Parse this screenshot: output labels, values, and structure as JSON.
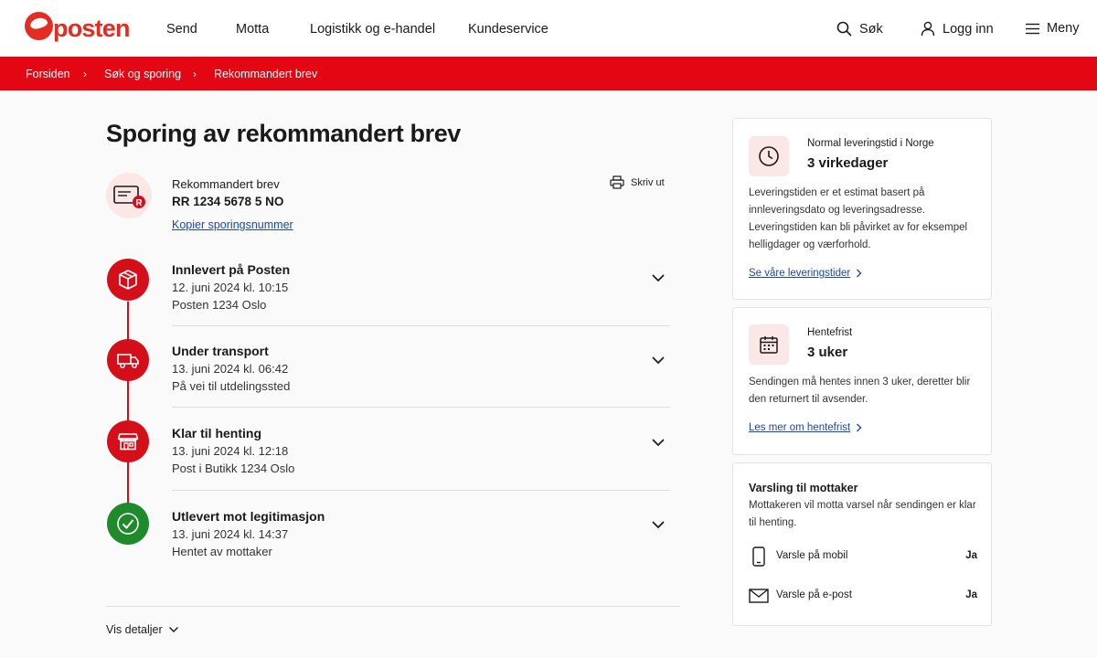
{
  "brand": {
    "name": "posten",
    "accent": "#e30613",
    "success": "#1f8a2b",
    "link": "#1c46a8"
  },
  "nav": {
    "items": [
      "Send",
      "Motta",
      "Logistikk og e-handel",
      "Kundeservice"
    ],
    "search": "Søk",
    "login": "Logg inn",
    "menu": "Meny"
  },
  "breadcrumb": [
    "Forsiden",
    "Søk og sporing",
    "Rekommandert brev"
  ],
  "page": {
    "title": "Sporing av rekommandert brev"
  },
  "shipment": {
    "type": "Rekommandert brev",
    "number": "RR 1234 5678 5 NO",
    "copy_link": "Kopier sporingsnummer",
    "print": "Skriv ut",
    "icon": "registered-letter-icon"
  },
  "events": [
    {
      "title": "Innlevert på Posten",
      "time": "12. juni 2024 kl. 10:15",
      "place": "Posten 1234 Oslo",
      "icon": "package-icon",
      "status": "done-step"
    },
    {
      "title": "Under transport",
      "time": "13. juni 2024 kl. 06:42",
      "place": "På vei til utdelingssted",
      "icon": "truck-icon",
      "status": "done-step"
    },
    {
      "title": "Klar til henting",
      "time": "13. juni 2024 kl. 12:18",
      "place": "Post i Butikk 1234 Oslo",
      "icon": "store-icon",
      "status": "done-step"
    },
    {
      "title": "Utlevert mot legitimasjon",
      "time": "13. juni 2024 kl. 14:37",
      "place": "Hentet av mottaker",
      "icon": "check-icon",
      "status": "delivered"
    }
  ],
  "details_toggle": "Vis detaljer",
  "delivery_card": {
    "label": "Normal leveringstid i Norge",
    "value": "3 virkedager",
    "text": "Leveringstiden er et estimat basert på innleveringsdato og leveringsadresse. Leveringstiden kan bli påvirket av for eksempel helligdager og værforhold.",
    "link": "Se våre leveringstider"
  },
  "pickup_card": {
    "label": "Hentefrist",
    "value": "3 uker",
    "text": "Sendingen må hentes innen 3 uker, deretter blir den returnert til avsender.",
    "link": "Les mer om hentefrist"
  },
  "notify_card": {
    "title": "Varsling til mottaker",
    "text": "Mottakeren vil motta varsel når sendingen er klar til henting.",
    "rows": [
      {
        "label": "Varsle på mobil",
        "value": "Ja",
        "icon": "mobile-icon"
      },
      {
        "label": "Varsle på e-post",
        "value": "Ja",
        "icon": "envelope-icon"
      }
    ]
  }
}
